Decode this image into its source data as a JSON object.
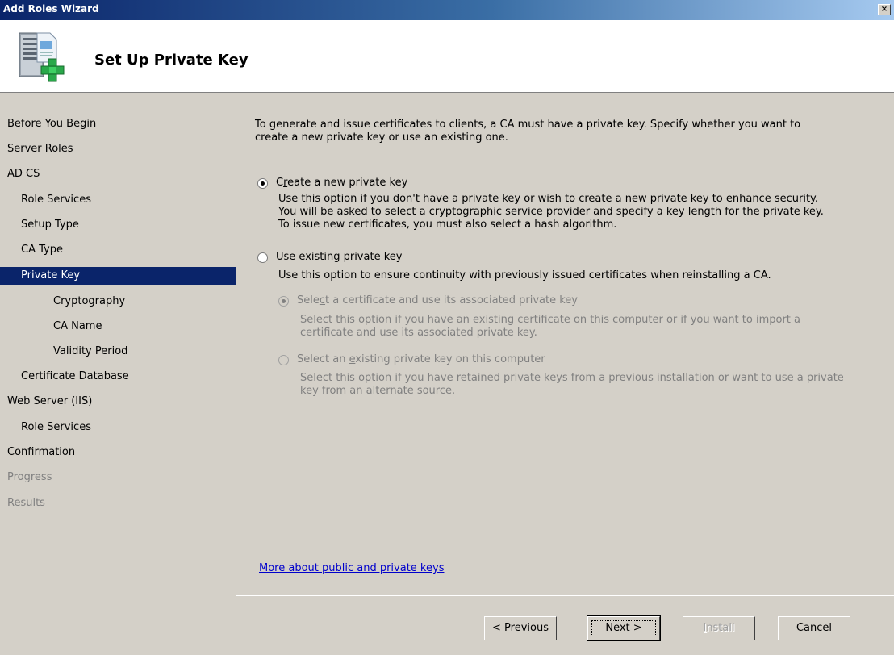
{
  "window": {
    "title": "Add Roles Wizard",
    "close_glyph": "×"
  },
  "header": {
    "title": "Set Up Private Key",
    "icon": "server-add-icon"
  },
  "nav": {
    "items": [
      {
        "label": "Before You Begin",
        "state": "normal"
      },
      {
        "label": "Server Roles",
        "state": "normal"
      },
      {
        "label": "AD CS",
        "state": "normal"
      },
      {
        "label": "Role Services",
        "state": "normal"
      },
      {
        "label": "Setup Type",
        "state": "normal"
      },
      {
        "label": "CA Type",
        "state": "normal"
      },
      {
        "label": "Private Key",
        "state": "selected"
      },
      {
        "label": "Cryptography",
        "state": "normal"
      },
      {
        "label": "CA Name",
        "state": "normal"
      },
      {
        "label": "Validity Period",
        "state": "normal"
      },
      {
        "label": "Certificate Database",
        "state": "normal"
      },
      {
        "label": "Web Server (IIS)",
        "state": "normal"
      },
      {
        "label": "Role Services",
        "state": "normal"
      },
      {
        "label": "Confirmation",
        "state": "normal"
      },
      {
        "label": "Progress",
        "state": "disabled"
      },
      {
        "label": "Results",
        "state": "disabled"
      }
    ]
  },
  "content": {
    "intro": [
      "To generate and issue certificates to clients, a CA must have a private key. Specify whether you want to",
      "create a new private key or use an existing one."
    ],
    "option_new": {
      "label_pre": "C",
      "label_accel": "r",
      "label_post": "eate a new private key",
      "checked": true,
      "description": [
        "Use this option if you don't have a private key or wish to create a new private key to enhance security.",
        "You will be asked to select a cryptographic service provider and specify a key length for the private key.",
        "To issue new certificates, you must also select a hash algorithm."
      ]
    },
    "option_existing": {
      "label_pre": "",
      "label_accel": "U",
      "label_post": "se existing private key",
      "checked": false,
      "description": [
        "Use this option to ensure continuity with previously issued certificates when reinstalling a CA."
      ]
    },
    "sub_option_cert": {
      "label_pre": "Sele",
      "label_accel": "c",
      "label_post": "t a certificate and use its associated private key",
      "checked": true,
      "enabled": false,
      "description": [
        "Select this option if you have an existing certificate on this computer or if you want to import a",
        "certificate and use its associated private key."
      ]
    },
    "sub_option_key": {
      "label_pre": "Select an ",
      "label_accel": "e",
      "label_post": "xisting private key on this computer",
      "checked": false,
      "enabled": false,
      "description": [
        "Select this option if you have retained private keys from a previous installation or want to use a private",
        "key from an alternate source."
      ]
    },
    "help_link": "More about public and private keys"
  },
  "footer": {
    "previous": {
      "pre": "< ",
      "accel": "P",
      "post": "revious"
    },
    "next": {
      "pre": "",
      "accel": "N",
      "post": "ext >"
    },
    "install": {
      "pre": "",
      "accel": "I",
      "post": "nstall"
    },
    "cancel": "Cancel"
  }
}
